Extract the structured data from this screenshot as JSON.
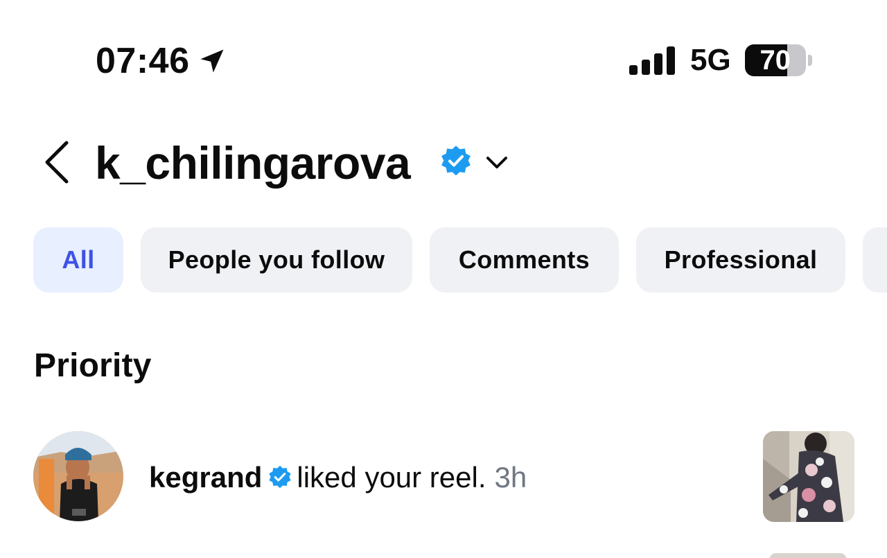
{
  "status_bar": {
    "time": "07:46",
    "network": "5G",
    "battery": "70",
    "battery_level": 0.7,
    "icons": [
      "location-arrow-icon",
      "cellular-signal-icon",
      "battery-icon"
    ]
  },
  "header": {
    "username": "k_chilingarova",
    "verified": true,
    "icons": [
      "back-chevron-icon",
      "verified-badge-icon",
      "chevron-down-icon"
    ]
  },
  "filters": {
    "items": [
      {
        "label": "All",
        "active": true
      },
      {
        "label": "People you follow",
        "active": false
      },
      {
        "label": "Comments",
        "active": false
      },
      {
        "label": "Professional",
        "active": false
      }
    ]
  },
  "section": {
    "title": "Priority"
  },
  "notifications": [
    {
      "user": "kegrand",
      "verified": true,
      "action": "liked your reel.",
      "time": "3h"
    }
  ],
  "colors": {
    "accent": "#3d52e6",
    "active_pill_bg": "#e8efff",
    "pill_bg": "#eff1f5",
    "verified_blue": "#1d9bf0",
    "muted_text": "#6f7782"
  }
}
